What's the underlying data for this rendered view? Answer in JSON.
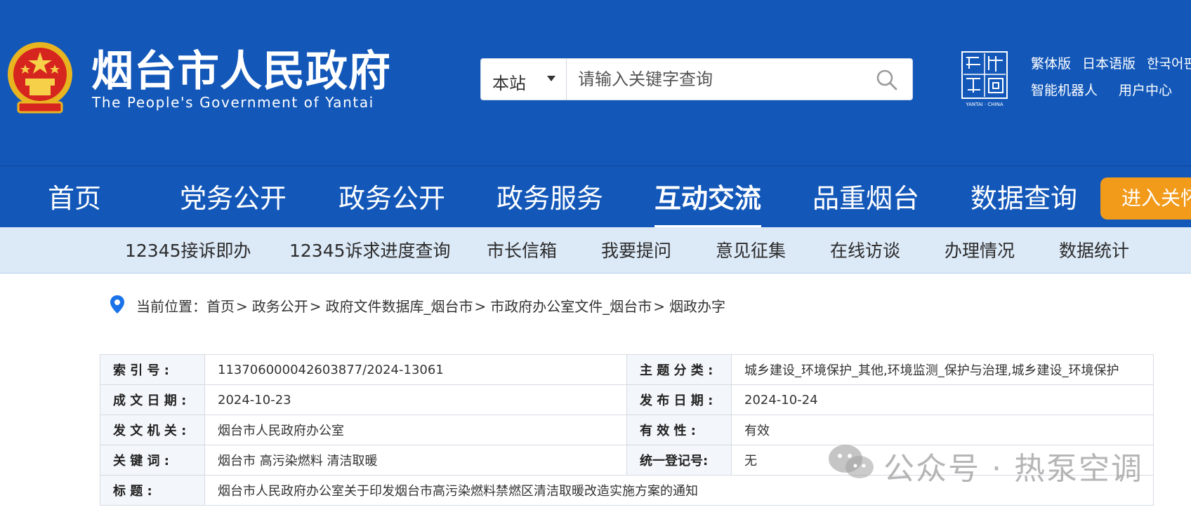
{
  "header": {
    "site_title": "烟台市人民政府",
    "site_subtitle": "The People's Government of Yantai",
    "search": {
      "scope": "本站",
      "placeholder": "请输入关键字查询"
    },
    "seal_caption": "YANTAI · CHINA",
    "lang_links": [
      "繁体版",
      "日本语版",
      "한국어판"
    ],
    "util_links": [
      "智能机器人",
      "用户中心"
    ]
  },
  "main_nav": {
    "items": [
      "首页",
      "党务公开",
      "政务公开",
      "政务服务",
      "互动交流",
      "品重烟台",
      "数据查询"
    ],
    "active": "互动交流",
    "enter_button": "进入关怀"
  },
  "sub_nav": {
    "items": [
      "12345接诉即办",
      "12345诉求进度查询",
      "市长信箱",
      "我要提问",
      "意见征集",
      "在线访谈",
      "办理情况",
      "数据统计"
    ]
  },
  "breadcrumb": {
    "prefix": "当前位置：",
    "items": [
      "首页",
      "政务公开",
      "政府文件数据库_烟台市",
      "市政府办公室文件_烟台市",
      "烟政办字"
    ],
    "separator": ">"
  },
  "info_table": {
    "rows": [
      {
        "l1": "索 引 号 :",
        "v1": "113706000042603877/2024-13061",
        "l2": "主 题 分 类 :",
        "v2": "城乡建设_环境保护_其他,环境监测_保护与治理,城乡建设_环境保护"
      },
      {
        "l1": "成 文 日 期 :",
        "v1": "2024-10-23",
        "l2": "发 布 日 期 :",
        "v2": "2024-10-24"
      },
      {
        "l1": "发 文 机 关 :",
        "v1": "烟台市人民政府办公室",
        "l2": "有 效 性 :",
        "v2": "有效"
      },
      {
        "l1": "关 键 词 :",
        "v1": "烟台市 高污染燃料 清洁取暖",
        "l2": "统一登记号:",
        "v2": "无"
      }
    ],
    "title_row": {
      "label": "标 题 :",
      "value": "烟台市人民政府办公室关于印发烟台市高污染燃料禁燃区清洁取暖改造实施方案的通知"
    }
  },
  "watermark": {
    "text": "公众号 · 热泵空调"
  },
  "colors": {
    "header_blue": "#1358b9",
    "subnav_bg": "#dce9f7",
    "enter_orange": "#f29a1a",
    "pin_blue": "#1a73e8"
  }
}
